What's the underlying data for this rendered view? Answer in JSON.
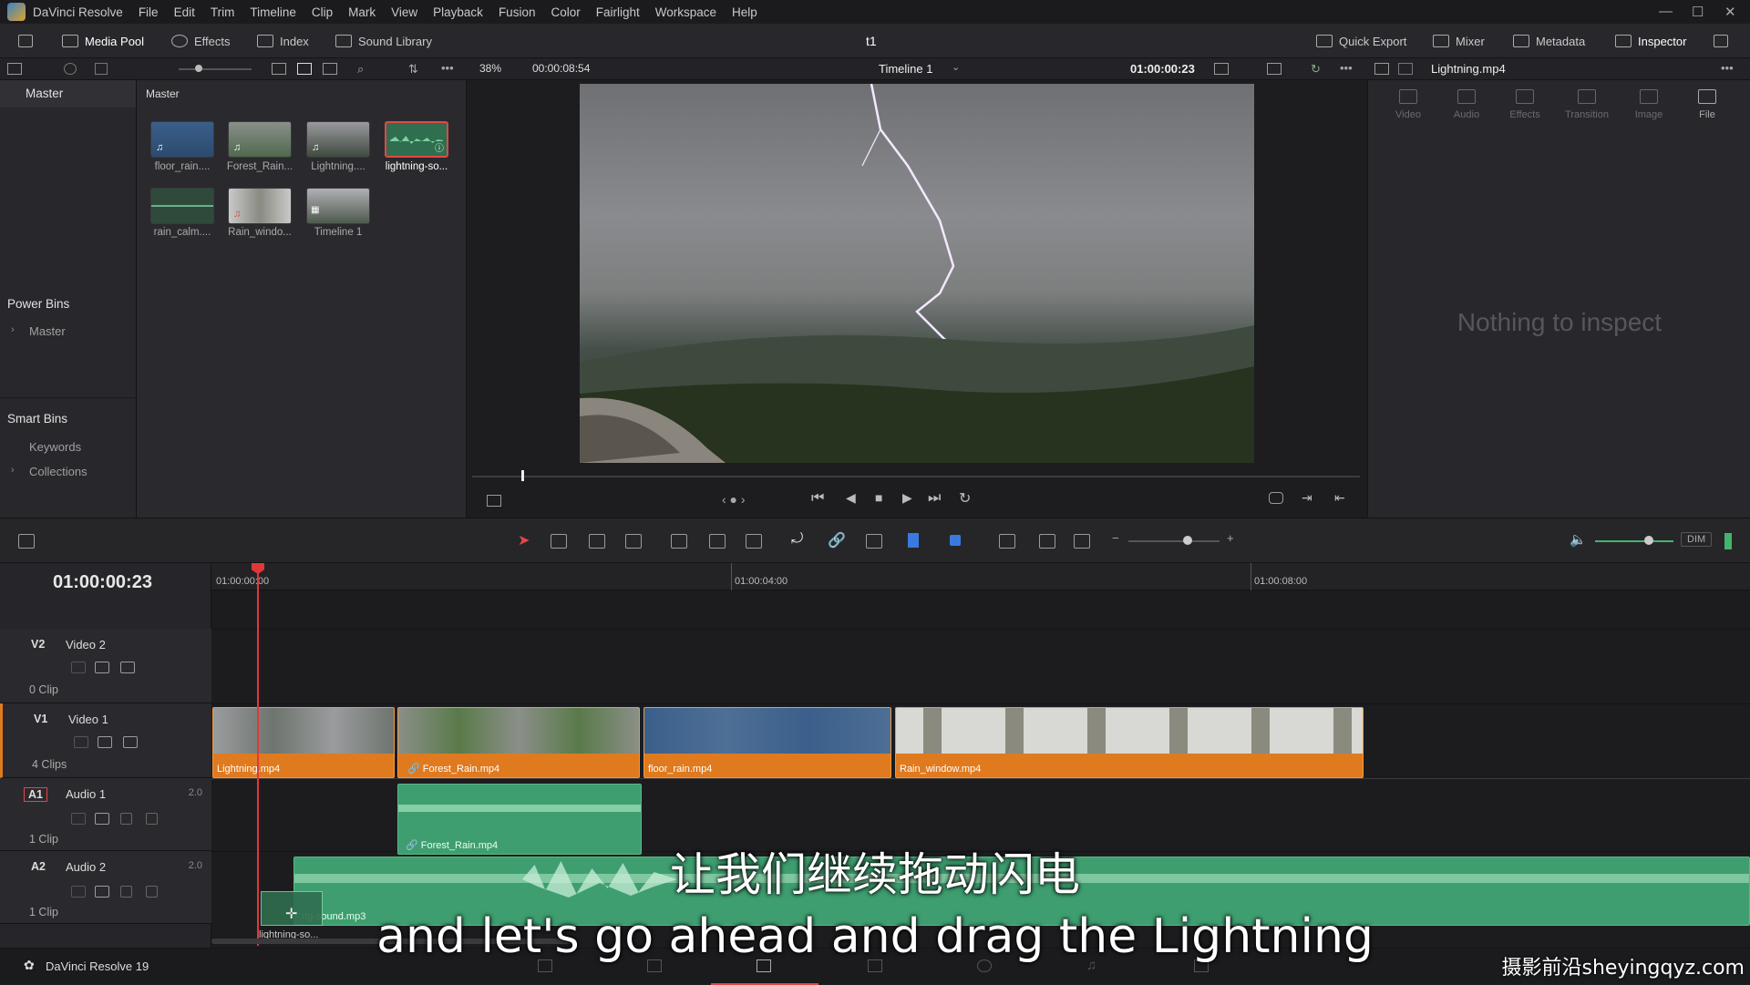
{
  "menubar": {
    "app": "DaVinci Resolve",
    "items": [
      "File",
      "Edit",
      "Trim",
      "Timeline",
      "Clip",
      "Mark",
      "View",
      "Playback",
      "Fusion",
      "Color",
      "Fairlight",
      "Workspace",
      "Help"
    ]
  },
  "toolbar": {
    "media_pool": "Media Pool",
    "effects": "Effects",
    "index": "Index",
    "sound_library": "Sound Library",
    "project_title": "t1",
    "quick_export": "Quick Export",
    "mixer": "Mixer",
    "metadata": "Metadata",
    "inspector": "Inspector"
  },
  "subbar": {
    "zoom": "38%",
    "duration": "00:00:08:54",
    "timeline_name": "Timeline 1",
    "timecode": "01:00:00:23",
    "inspector_clip": "Lightning.mp4"
  },
  "bins": {
    "master": "Master",
    "power_bins": "Power Bins",
    "power_master": "Master",
    "smart_bins": "Smart Bins",
    "keywords": "Keywords",
    "collections": "Collections"
  },
  "pool": {
    "header": "Master",
    "clips": [
      {
        "label": "floor_rain...."
      },
      {
        "label": "Forest_Rain..."
      },
      {
        "label": "Lightning...."
      },
      {
        "label": "lightning-so..."
      },
      {
        "label": "rain_calm...."
      },
      {
        "label": "Rain_windo..."
      },
      {
        "label": "Timeline 1"
      }
    ]
  },
  "inspector": {
    "tabs": [
      "Video",
      "Audio",
      "Effects",
      "Transition",
      "Image",
      "File"
    ],
    "empty": "Nothing to inspect"
  },
  "timeline": {
    "timecode": "01:00:00:23",
    "ruler": [
      "01:00:00:00",
      "01:00:04:00",
      "01:00:08:00"
    ],
    "dim": "DIM",
    "tracks": {
      "v2": {
        "id": "V2",
        "name": "Video 2",
        "count": "0 Clip"
      },
      "v1": {
        "id": "V1",
        "name": "Video 1",
        "count": "4 Clips"
      },
      "a1": {
        "id": "A1",
        "name": "Audio 1",
        "count": "1 Clip",
        "level": "2.0"
      },
      "a2": {
        "id": "A2",
        "name": "Audio 2",
        "count": "1 Clip",
        "level": "2.0"
      }
    },
    "video_clips": [
      "Lightning.mp4",
      "Forest_Rain.mp4",
      "floor_rain.mp4",
      "Rain_window.mp4"
    ],
    "audio1_clip": "Forest_Rain.mp4",
    "audio2_clip": "ng-sound.mp3",
    "drag_label": "lightning-so..."
  },
  "status": {
    "app": "DaVinci Resolve 19"
  },
  "subtitles": {
    "cn": "让我们继续拖动闪电",
    "en": "and let's go ahead and drag the Lightning"
  },
  "watermark": "摄影前沿sheyingqyz.com",
  "colors": {
    "accent": "#e07a1f",
    "audio": "#3e9e70",
    "playhead": "#e0383a"
  }
}
